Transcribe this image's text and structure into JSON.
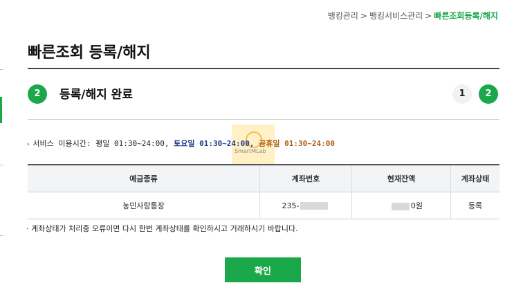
{
  "breadcrumb": {
    "item1": "뱅킹관리",
    "item2": "뱅킹서비스관리",
    "current": "빠른조회등록/해지",
    "separator": ">"
  },
  "page": {
    "title": "빠른조회 등록/해지"
  },
  "step": {
    "number": "2",
    "title": "등록/해지 완료",
    "indicators": [
      "1",
      "2"
    ]
  },
  "service_time": {
    "prefix": "서비스 이용시간: 평일 01:30~24:00,",
    "saturday": "토요일 01:30~24:00,",
    "holiday": "공휴일 01:30~24:00"
  },
  "watermark": {
    "text": "SmartMLab"
  },
  "table": {
    "headers": [
      "예금종류",
      "계좌번호",
      "현재잔액",
      "계좌상태"
    ],
    "rows": [
      {
        "type": "농민사랑통장",
        "account_prefix": "235-",
        "balance_suffix": "0원",
        "status": "등록"
      }
    ]
  },
  "note": "계좌상태가 처리중 오류이면 다시 한번 계좌상태를 확인하시고 거래하시기 바랍니다.",
  "button": {
    "confirm": "확인"
  },
  "colors": {
    "accent": "#1aa84a",
    "saturday": "#1d3a8a",
    "holiday": "#b05a10"
  }
}
